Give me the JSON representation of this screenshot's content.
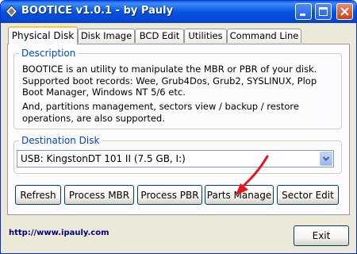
{
  "window": {
    "title": "BOOTICE v1.0.1 - by Pauly"
  },
  "titlebar_buttons": [
    "minimize-button",
    "maximize-button",
    "close-button"
  ],
  "tabs": [
    {
      "label": "Physical Disk",
      "active": true
    },
    {
      "label": "Disk Image",
      "active": false
    },
    {
      "label": "BCD Edit",
      "active": false
    },
    {
      "label": "Utilities",
      "active": false
    },
    {
      "label": "Command Line",
      "active": false
    }
  ],
  "description": {
    "legend": "Description",
    "paragraph1": "BOOTICE is an utility to manipulate the MBR or PBR of your disk. Supported boot records: Wee, Grub4Dos, Grub2, SYSLINUX, Plop Boot Manager, Windows NT 5/6 etc.",
    "paragraph2": "And, partitions management, sectors view / backup / restore operations, are also supported."
  },
  "destination": {
    "legend": "Destination Disk",
    "selected": "USB: KingstonDT 101 II (7.5 GB, I:)"
  },
  "actions": {
    "refresh": "Refresh",
    "process_mbr": "Process MBR",
    "process_pbr": "Process PBR",
    "parts_manage": "Parts Manage",
    "sector_edit": "Sector Edit"
  },
  "footer": {
    "url": "http://www.ipauly.com",
    "exit": "Exit"
  },
  "colors": {
    "titlebar": "#0553e1",
    "legend_text": "#0046d5",
    "annotation_arrow": "#e8141c",
    "active_tab_highlight": "#ffc83c"
  }
}
